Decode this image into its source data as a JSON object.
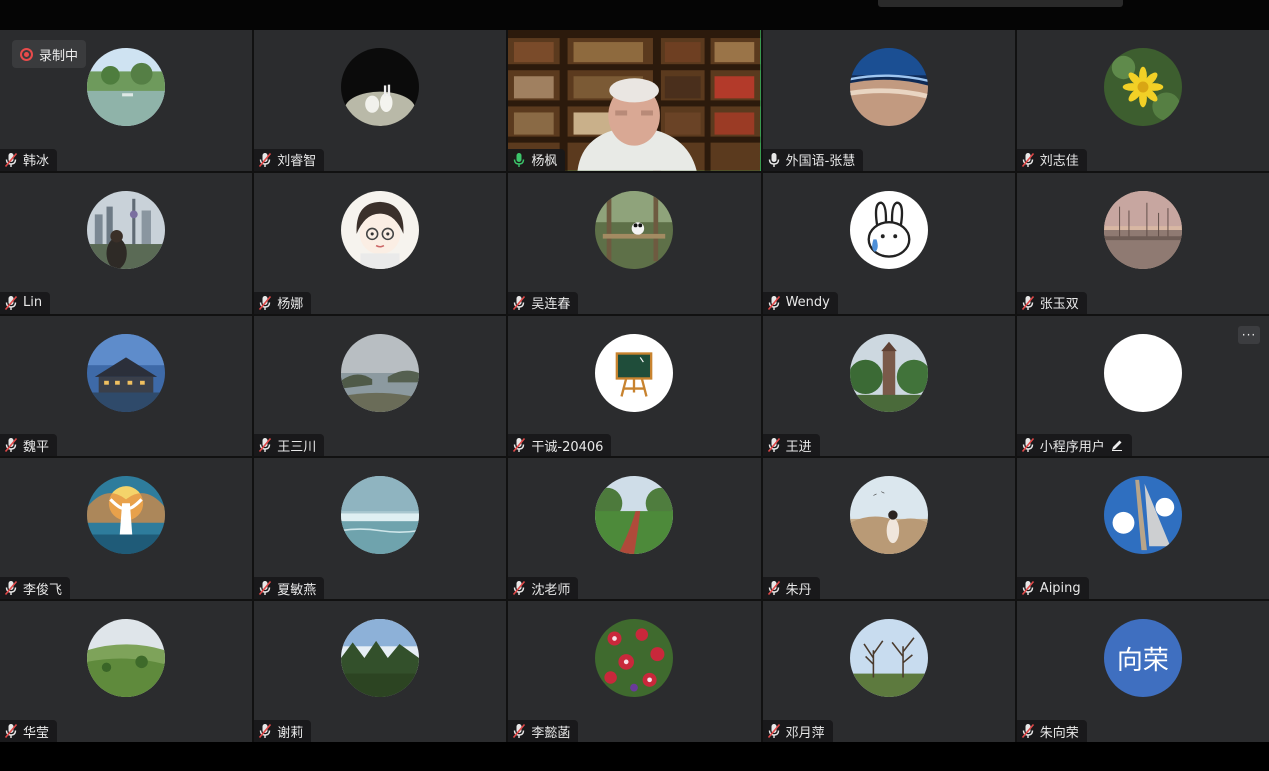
{
  "recording": {
    "label": "录制中"
  },
  "more_label": "···",
  "colors": {
    "tile_bg": "#2b2c2e",
    "speaking_border": "#2fb35c",
    "recording_red": "#e84b4b",
    "avatar_text_bg": "#3f6fc0"
  },
  "participants": [
    {
      "name": "韩冰",
      "mic": "muted",
      "avatar": "lake-park-photo"
    },
    {
      "name": "刘睿智",
      "mic": "muted",
      "avatar": "rabbits-photo"
    },
    {
      "name": "杨枫",
      "mic": "active",
      "avatar": "video-bookshelf-man"
    },
    {
      "name": "外国语-张慧",
      "mic": "unmuted",
      "avatar": "earth-from-space-photo"
    },
    {
      "name": "刘志佳",
      "mic": "muted",
      "avatar": "yellow-flower-photo"
    },
    {
      "name": "Lin",
      "mic": "muted",
      "avatar": "city-skyline-photo"
    },
    {
      "name": "杨娜",
      "mic": "muted",
      "avatar": "cartoon-girl-drawing"
    },
    {
      "name": "吴连春",
      "mic": "muted",
      "avatar": "panda-forest-photo"
    },
    {
      "name": "Wendy",
      "mic": "muted",
      "avatar": "bunny-sticker"
    },
    {
      "name": "张玉双",
      "mic": "muted",
      "avatar": "harbor-sunset-photo"
    },
    {
      "name": "魏平",
      "mic": "muted",
      "avatar": "lodge-night-photo"
    },
    {
      "name": "王三川",
      "mic": "muted",
      "avatar": "coastline-photo"
    },
    {
      "name": "干诚-20406",
      "mic": "muted",
      "avatar": "chalkboard-easel-icon"
    },
    {
      "name": "王进",
      "mic": "muted",
      "avatar": "tower-trees-photo"
    },
    {
      "name": "小程序用户",
      "mic": "muted",
      "avatar": "blank-white",
      "edit_icon": true,
      "more_button": true
    },
    {
      "name": "李俊飞",
      "mic": "muted",
      "avatar": "fantasy-pegasus-art"
    },
    {
      "name": "夏敏燕",
      "mic": "muted",
      "avatar": "sea-horizon-photo"
    },
    {
      "name": "沈老师",
      "mic": "muted",
      "avatar": "park-path-photo"
    },
    {
      "name": "朱丹",
      "mic": "muted",
      "avatar": "girl-dunes-photo"
    },
    {
      "name": "Aiping",
      "mic": "muted",
      "avatar": "sail-sky-photo"
    },
    {
      "name": "华莹",
      "mic": "muted",
      "avatar": "green-hills-photo"
    },
    {
      "name": "谢莉",
      "mic": "muted",
      "avatar": "forest-sky-photo"
    },
    {
      "name": "李懿菡",
      "mic": "muted",
      "avatar": "flowers-pattern-photo"
    },
    {
      "name": "邓月萍",
      "mic": "muted",
      "avatar": "winter-trees-photo"
    },
    {
      "name": "朱向荣",
      "mic": "muted",
      "avatar": "text-avatar",
      "avatar_text": "向荣"
    }
  ]
}
